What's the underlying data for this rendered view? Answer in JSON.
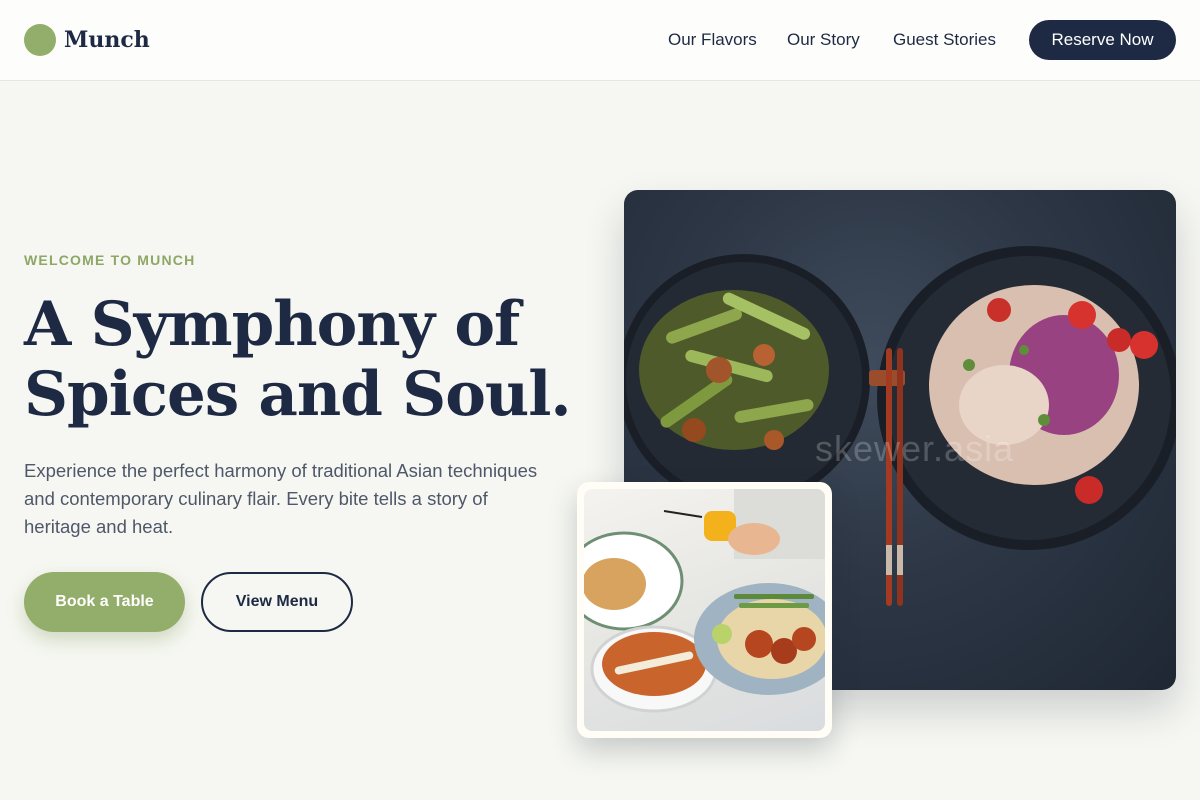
{
  "brand": {
    "name": "Munch",
    "accent": "#93ad6b",
    "ink": "#1e2a44"
  },
  "nav": {
    "items": [
      {
        "label": "Our Flavors"
      },
      {
        "label": "Our Story"
      },
      {
        "label": "Guest Stories"
      }
    ],
    "cta": "Reserve Now"
  },
  "hero": {
    "eyebrow": "WELCOME TO MUNCH",
    "headline_line1": "A Symphony of",
    "headline_line2": "Spices and Soul.",
    "lede": "Experience the perfect harmony of traditional Asian techniques and contemporary culinary flair. Every bite tells a story of heritage and heat.",
    "primary_cta": "Book a Table",
    "secondary_cta": "View Menu"
  },
  "images": {
    "main_photo_watermark": "skewer.asia"
  },
  "icons": {
    "brand_mark": "brand-circle-icon"
  }
}
